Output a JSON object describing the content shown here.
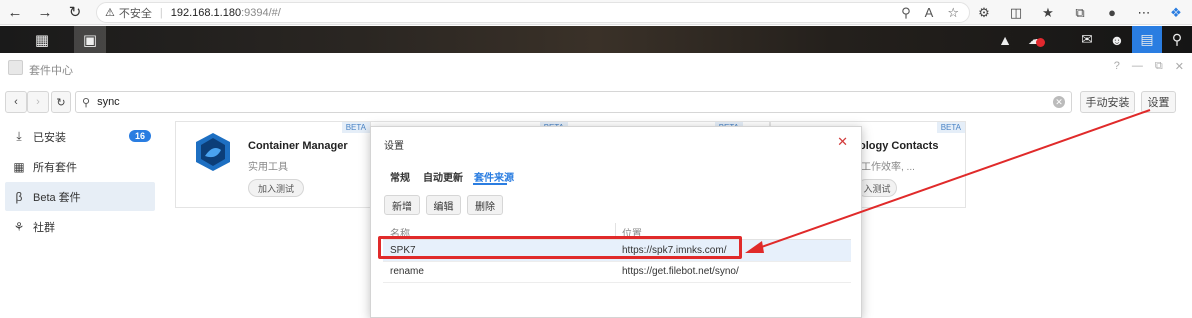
{
  "browser": {
    "back_icon": "arrow-left-icon",
    "forward_icon": "arrow-right-icon",
    "reload_icon": "reload-icon",
    "home_icon": "home-icon",
    "insecure_label": "不安全",
    "url_host": "192.168.1.180",
    "url_rest": ":9394/#/"
  },
  "app": {
    "title": "套件中心",
    "search_value": "sync",
    "manual_install_label": "手动安装",
    "settings_label": "设置"
  },
  "sidebar": {
    "items": [
      {
        "label": "已安装",
        "icon": "download-icon",
        "count": "16"
      },
      {
        "label": "所有套件",
        "icon": "grid-icon"
      },
      {
        "label": "Beta 套件",
        "icon": "beta-icon"
      },
      {
        "label": "社群",
        "icon": "community-icon"
      }
    ]
  },
  "packages": [
    {
      "name": "Container Manager",
      "category": "实用工具",
      "badge": "BETA",
      "action": "加入测试"
    },
    {
      "name": "ology Contacts",
      "category": "工作效率, ...",
      "badge": "BETA",
      "action": "入测试"
    }
  ],
  "hidden_badges": [
    "BETA",
    "BETA"
  ],
  "dialog": {
    "title": "设置",
    "tabs": [
      "常规",
      "自动更新",
      "套件来源"
    ],
    "active_tab": "套件来源",
    "buttons": [
      "新增",
      "编辑",
      "删除"
    ],
    "columns": [
      "名称",
      "位置"
    ],
    "rows": [
      {
        "name": "SPK7",
        "location": "https://spk7.imnks.com/"
      },
      {
        "name": "rename",
        "location": "https://get.filebot.net/syno/"
      }
    ]
  },
  "colors": {
    "accent": "#2a7de1",
    "annotation": "#e02a2a"
  }
}
